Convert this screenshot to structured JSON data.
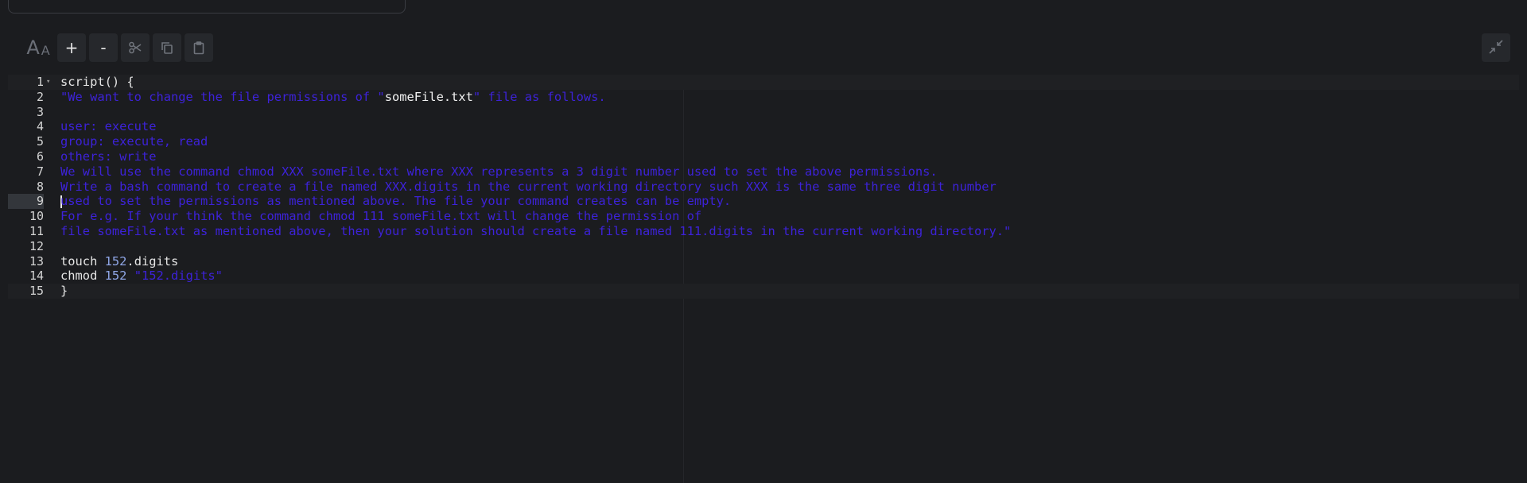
{
  "toolbar": {
    "font_size_icon": "font-size-icon",
    "increase_label": "+",
    "decrease_label": "-",
    "cut_icon": "scissors-icon",
    "copy_icon": "copy-icon",
    "paste_icon": "clipboard-icon",
    "collapse_icon": "collapse-icon"
  },
  "editor": {
    "lines": [
      {
        "num": "1",
        "segments": [
          {
            "t": "script() {",
            "c": "plain"
          }
        ]
      },
      {
        "num": "2",
        "segments": [
          {
            "t": "\"We want to change the file permissions of \"",
            "c": "str"
          },
          {
            "t": "someFile.txt",
            "c": "hl"
          },
          {
            "t": "\" file as follows.",
            "c": "str"
          }
        ]
      },
      {
        "num": "3",
        "segments": []
      },
      {
        "num": "4",
        "segments": [
          {
            "t": "user: execute",
            "c": "str"
          }
        ]
      },
      {
        "num": "5",
        "segments": [
          {
            "t": "group: execute, read",
            "c": "str"
          }
        ]
      },
      {
        "num": "6",
        "segments": [
          {
            "t": "others: write",
            "c": "str"
          }
        ]
      },
      {
        "num": "7",
        "segments": [
          {
            "t": "We will use the command chmod XXX someFile.txt where XXX represents a 3 digit number used to set the above permissions.",
            "c": "str"
          }
        ]
      },
      {
        "num": "8",
        "segments": [
          {
            "t": "Write a bash command to create a file named XXX.digits in the current working directory such XXX is the same three digit number",
            "c": "str"
          }
        ]
      },
      {
        "num": "9",
        "segments": [
          {
            "t": "used to set the permissions as mentioned above. The file your command creates can be empty.",
            "c": "str"
          }
        ]
      },
      {
        "num": "10",
        "segments": [
          {
            "t": "For e.g. If your think the command chmod 111 someFile.txt will change the permission of",
            "c": "str"
          }
        ]
      },
      {
        "num": "11",
        "segments": [
          {
            "t": "file someFile.txt as mentioned above, then your solution should create a file named 111.digits in the current working directory.\"",
            "c": "str"
          }
        ]
      },
      {
        "num": "12",
        "segments": []
      },
      {
        "num": "13",
        "segments": [
          {
            "t": "touch ",
            "c": "plain"
          },
          {
            "t": "152",
            "c": "num"
          },
          {
            "t": ".digits",
            "c": "plain"
          }
        ]
      },
      {
        "num": "14",
        "segments": [
          {
            "t": "chmod ",
            "c": "plain"
          },
          {
            "t": "152",
            "c": "num"
          },
          {
            "t": " ",
            "c": "plain"
          },
          {
            "t": "\"152.digits\"",
            "c": "str"
          }
        ]
      },
      {
        "num": "15",
        "segments": [
          {
            "t": "}",
            "c": "plain"
          }
        ]
      }
    ]
  }
}
